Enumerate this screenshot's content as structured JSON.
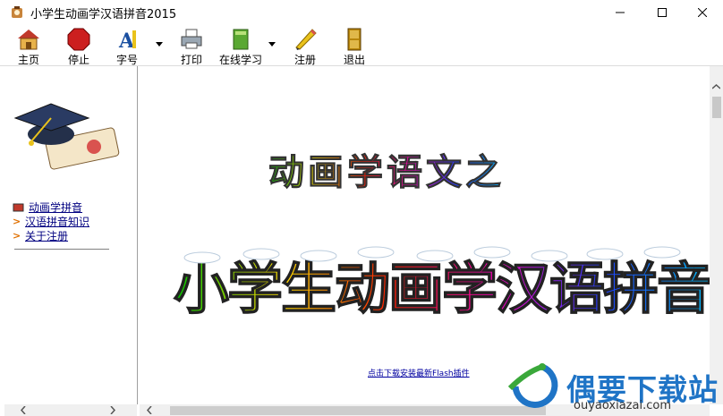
{
  "window": {
    "title": "小学生动画学汉语拼音2015",
    "controls": [
      "minimize",
      "maximize",
      "close"
    ]
  },
  "toolbar": {
    "items": [
      {
        "label": "主页",
        "icon": "home-icon"
      },
      {
        "label": "停止",
        "icon": "stop-icon"
      },
      {
        "label": "字号",
        "icon": "font-size-icon",
        "dropdown": true
      },
      {
        "label": "打印",
        "icon": "printer-icon"
      },
      {
        "label": "在线学习",
        "icon": "book-icon",
        "dropdown": true
      },
      {
        "label": "注册",
        "icon": "pencil-icon"
      },
      {
        "label": "退出",
        "icon": "exit-icon"
      }
    ]
  },
  "sidebar": {
    "logo": "graduation-cap-diploma-icon",
    "items": [
      {
        "label": "动画学拼音",
        "bullet": "book-bullet-icon"
      },
      {
        "label": "汉语拼音知识",
        "bullet": ">"
      },
      {
        "label": "关于注册",
        "bullet": ">"
      }
    ]
  },
  "main": {
    "subtitle": "动画学语文之",
    "title": "小学生动画学汉语拼音",
    "flash_link": "点击下载安装最新Flash插件"
  },
  "watermark": {
    "brand": "偶要下载站",
    "url": "ouyaoxiazai.com"
  },
  "colors": {
    "accent": "#1f74c6",
    "link": "#000080",
    "bullet": "#e07000"
  }
}
